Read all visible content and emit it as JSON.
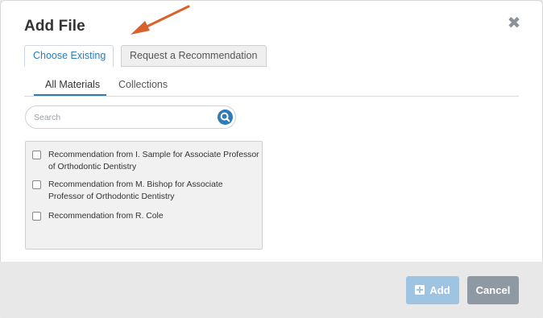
{
  "dialog": {
    "title": "Add File",
    "close_symbol": "✖"
  },
  "tabs": [
    {
      "label": "Choose Existing",
      "active": true
    },
    {
      "label": "Request a Recommendation",
      "active": false
    }
  ],
  "subtabs": [
    {
      "label": "All Materials",
      "active": true
    },
    {
      "label": "Collections",
      "active": false
    }
  ],
  "search": {
    "placeholder": "Search",
    "value": ""
  },
  "items": [
    {
      "label": "Recommendation from I. Sample for Associate Professor of Orthodontic Dentistry",
      "checked": false
    },
    {
      "label": "Recommendation from M. Bishop for Associate Professor of Orthodontic Dentistry",
      "checked": false
    },
    {
      "label": "Recommendation from R. Cole",
      "checked": false
    }
  ],
  "footer": {
    "add_label": "Add",
    "cancel_label": "Cancel"
  },
  "colors": {
    "accent": "#2d7bb9",
    "add_button_disabled": "#9ec4e2",
    "cancel_button": "#8f99a3",
    "annotation_arrow": "#d9622b"
  },
  "icons": {
    "close": "close-icon",
    "search": "search-icon",
    "add": "plus-square-icon",
    "annotation": "arrow-annotation-icon"
  }
}
